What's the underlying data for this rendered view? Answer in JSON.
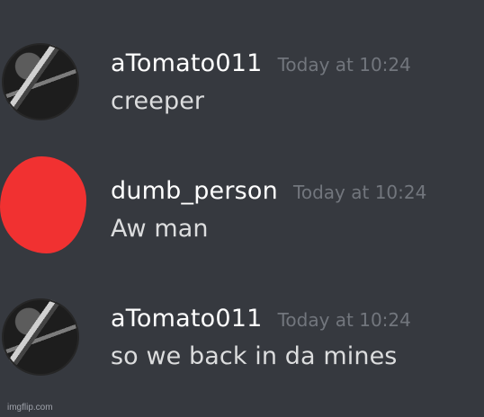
{
  "chat": {
    "messages": [
      {
        "username": "aTomato011",
        "timestamp": "Today at 10:24",
        "content": "creeper",
        "avatar": "photo-avatar-icon"
      },
      {
        "username": "dumb_person",
        "timestamp": "Today at 10:24",
        "content": "Aw man",
        "avatar": "red-scribble-avatar-icon"
      },
      {
        "username": "aTomato011",
        "timestamp": "Today at 10:24",
        "content": "so we back in da mines",
        "avatar": "photo-avatar-icon"
      }
    ]
  },
  "watermark": {
    "text": "imgflip.com"
  },
  "colors": {
    "background": "#36393f",
    "username": "#ffffff",
    "timestamp": "#72767d",
    "message_text": "#dcddde",
    "red_avatar": "#f13131"
  }
}
